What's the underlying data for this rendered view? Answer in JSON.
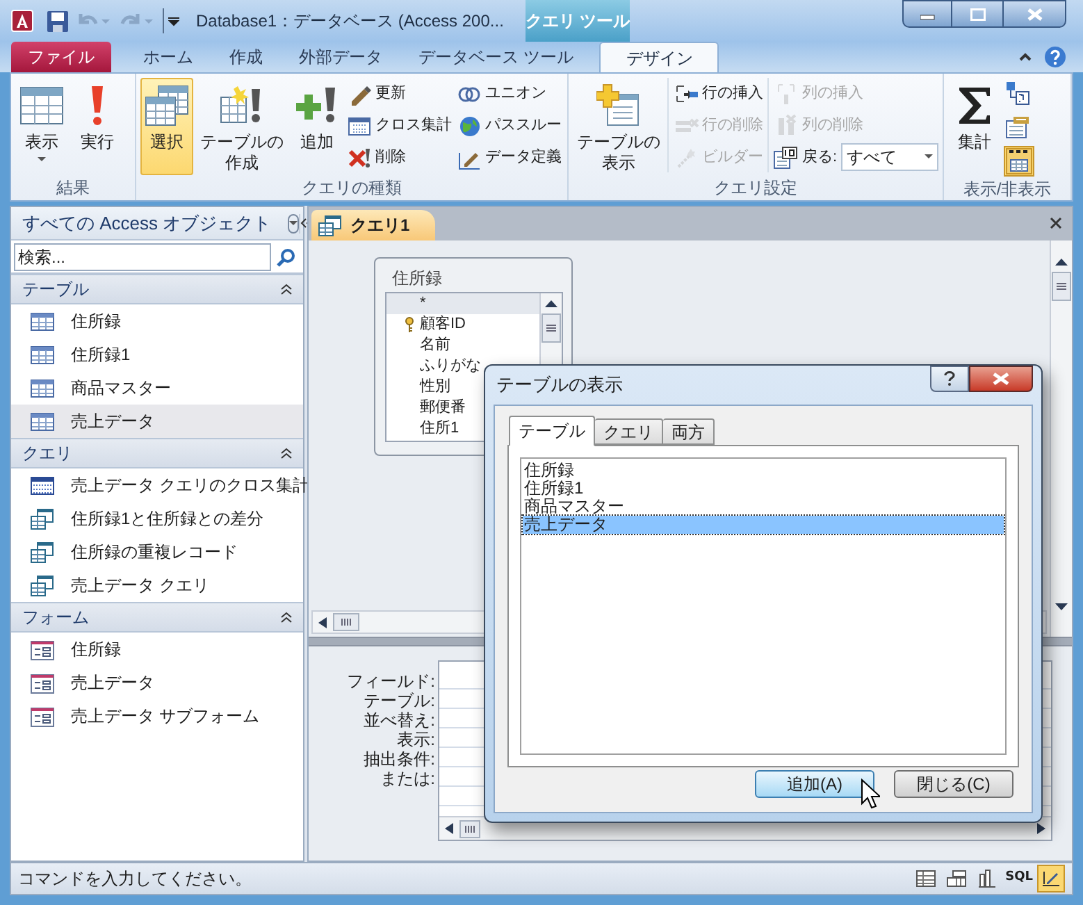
{
  "window": {
    "title": "Database1：データベース (Access 200...",
    "context_tab": "クエリ ツール"
  },
  "ribbon_tabs": [
    {
      "label": "ファイル",
      "kind": "file",
      "selected": false
    },
    {
      "label": "ホーム",
      "kind": "tab",
      "selected": false
    },
    {
      "label": "作成",
      "kind": "tab",
      "selected": false
    },
    {
      "label": "外部データ",
      "kind": "tab",
      "selected": false
    },
    {
      "label": "データベース ツール",
      "kind": "tab",
      "selected": false
    },
    {
      "label": "デザイン",
      "kind": "tab",
      "selected": true
    }
  ],
  "ribbon_groups": [
    {
      "label": "結果",
      "items": [
        {
          "kind": "large",
          "label": "表示",
          "menu": true,
          "selected": false
        },
        {
          "kind": "large",
          "label": "実行",
          "selected": false
        }
      ]
    },
    {
      "label": "クエリの種類",
      "items": [
        {
          "kind": "large",
          "label": "選択",
          "selected": true
        },
        {
          "kind": "large",
          "label": "テーブルの作成",
          "selected": false
        },
        {
          "kind": "large",
          "label": "追加",
          "selected": false
        },
        {
          "kind": "column",
          "items": [
            {
              "kind": "button",
              "label": "更新",
              "disabled": false
            },
            {
              "kind": "button",
              "label": "クロス集計",
              "disabled": false
            },
            {
              "kind": "button",
              "label": "削除",
              "disabled": false
            }
          ]
        },
        {
          "kind": "column",
          "items": [
            {
              "kind": "button",
              "label": "ユニオン",
              "disabled": false
            },
            {
              "kind": "button",
              "label": "パススルー",
              "disabled": false
            },
            {
              "kind": "button",
              "label": "データ定義",
              "disabled": false
            }
          ]
        }
      ]
    },
    {
      "label": "クエリ設定",
      "items": [
        {
          "kind": "large",
          "label": "テーブルの表示",
          "selected": false
        },
        {
          "kind": "column",
          "items": [
            {
              "kind": "button",
              "label": "行の挿入",
              "disabled": false
            },
            {
              "kind": "button",
              "label": "行の削除",
              "disabled": true
            },
            {
              "kind": "button",
              "label": "ビルダー",
              "disabled": true
            }
          ]
        },
        {
          "kind": "column",
          "items": [
            {
              "kind": "button",
              "label": "列の挿入",
              "disabled": true
            },
            {
              "kind": "button",
              "label": "列の削除",
              "disabled": true
            },
            {
              "kind": "combo",
              "label": "戻る:",
              "value": "すべて"
            }
          ]
        }
      ]
    },
    {
      "label": "表示/非表示",
      "items": [
        {
          "kind": "large",
          "label": "集計",
          "selected": false
        },
        {
          "kind": "toggles",
          "items": [
            {
              "selected": false
            },
            {
              "selected": false
            },
            {
              "selected": true
            }
          ]
        }
      ]
    }
  ],
  "nav": {
    "title": "すべての Access オブジェクト",
    "search_placeholder": "検索...",
    "groups": [
      {
        "label": "テーブル",
        "expanded": true,
        "items": [
          {
            "label": "住所録",
            "kind": "table",
            "selected": false
          },
          {
            "label": "住所録1",
            "kind": "table",
            "selected": false
          },
          {
            "label": "商品マスター",
            "kind": "table",
            "selected": false
          },
          {
            "label": "売上データ",
            "kind": "table",
            "selected": true
          }
        ]
      },
      {
        "label": "クエリ",
        "expanded": true,
        "items": [
          {
            "label": "売上データ クエリのクロス集計",
            "kind": "crosstab",
            "selected": false
          },
          {
            "label": "住所録1と住所録との差分",
            "kind": "query",
            "selected": false
          },
          {
            "label": "住所録の重複レコード",
            "kind": "query",
            "selected": false
          },
          {
            "label": "売上データ クエリ",
            "kind": "query",
            "selected": false
          }
        ]
      },
      {
        "label": "フォーム",
        "expanded": true,
        "items": [
          {
            "label": "住所録",
            "kind": "form",
            "selected": false
          },
          {
            "label": "売上データ",
            "kind": "form",
            "selected": false
          },
          {
            "label": "売上データ サブフォーム",
            "kind": "form",
            "selected": false
          }
        ]
      }
    ]
  },
  "document_tabs": [
    {
      "label": "クエリ1",
      "selected": true
    }
  ],
  "table_boxes": [
    {
      "title": "住所録",
      "fields": [
        {
          "label": "*",
          "primary_key": false,
          "selected": true
        },
        {
          "label": "顧客ID",
          "primary_key": true,
          "selected": false
        },
        {
          "label": "名前",
          "primary_key": false,
          "selected": false
        },
        {
          "label": "ふりがな",
          "primary_key": false,
          "selected": false
        },
        {
          "label": "性別",
          "primary_key": false,
          "selected": false
        },
        {
          "label": "郵便番",
          "primary_key": false,
          "selected": false
        },
        {
          "label": "住所1",
          "primary_key": false,
          "selected": false
        }
      ]
    }
  ],
  "grid_rows": [
    "フィールド:",
    "テーブル:",
    "並べ替え:",
    "表示:",
    "抽出条件:",
    "または:"
  ],
  "dialog": {
    "title": "テーブルの表示",
    "tabs": [
      {
        "label": "テーブル",
        "selected": true
      },
      {
        "label": "クエリ",
        "selected": false
      },
      {
        "label": "両方",
        "selected": false
      }
    ],
    "items": [
      {
        "label": "住所録",
        "selected": false
      },
      {
        "label": "住所録1",
        "selected": false
      },
      {
        "label": "商品マスター",
        "selected": false
      },
      {
        "label": "売上データ",
        "selected": true
      }
    ],
    "buttons": [
      {
        "label": "追加(A)",
        "default": true
      },
      {
        "label": "閉じる(C)",
        "default": false
      }
    ]
  },
  "status_bar": {
    "text": "コマンドを入力してください。",
    "views": [
      {
        "kind": "datasheet",
        "selected": false
      },
      {
        "kind": "pivot_table",
        "selected": false
      },
      {
        "kind": "pivot_chart",
        "selected": false
      },
      {
        "kind": "sql",
        "label": "SQL",
        "selected": false
      },
      {
        "kind": "design",
        "selected": true
      }
    ]
  }
}
